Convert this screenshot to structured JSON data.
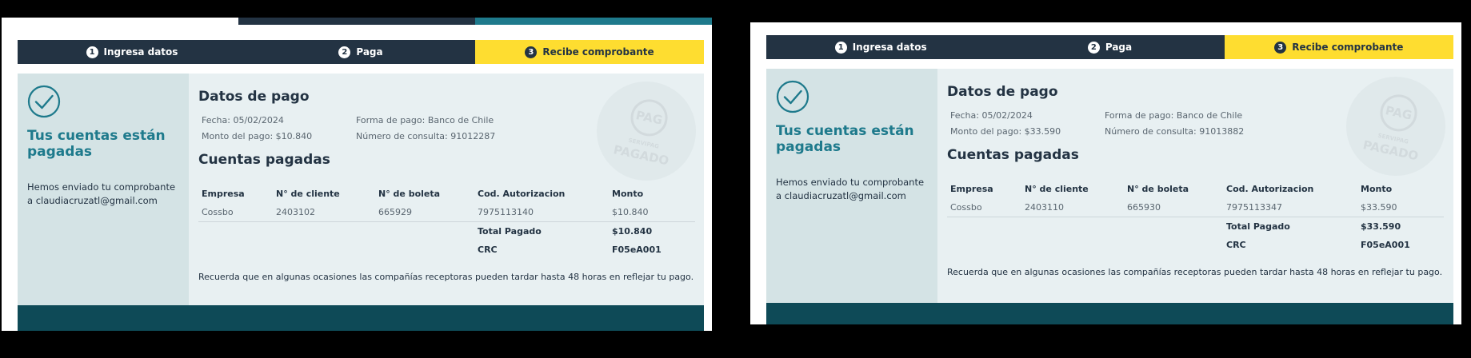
{
  "colors": {
    "background": "#000000",
    "card": "#ffffff",
    "navy": "#233343",
    "accent_yellow": "#fedd30",
    "teal_title": "#1e7a8c",
    "teal_dark": "#0e4a57",
    "side_panel": "#d4e3e5",
    "main_panel": "#e8f0f2",
    "stamp": "#d2dadd"
  },
  "receipts": [
    {
      "topbar": [
        "#ffffff",
        "#233343",
        "#1e7a8c"
      ],
      "steps": [
        {
          "number": "1",
          "label": "Ingresa datos",
          "active": false
        },
        {
          "number": "2",
          "label": "Paga",
          "active": false
        },
        {
          "number": "3",
          "label": "Recibe comprobante",
          "active": true
        }
      ],
      "side": {
        "icon": "check-circle-icon",
        "title": "Tus cuentas están pagadas",
        "message": "Hemos enviado tu comprobante a claudiacruzatl@gmail.com"
      },
      "payment": {
        "heading": "Datos de pago",
        "fecha": "Fecha: 05/02/2024",
        "forma": "Forma de pago: Banco de Chile",
        "monto": "Monto del pago: $10.840",
        "consulta": "Número de consulta: 91012287"
      },
      "paid": {
        "heading": "Cuentas pagadas",
        "headers": [
          "Empresa",
          "N° de cliente",
          "N° de boleta",
          "Cod. Autorizacion",
          "Monto"
        ],
        "row": [
          "Cossbo",
          "2403102",
          "665929",
          "7975113140",
          "$10.840"
        ],
        "total_label": "Total Pagado",
        "total_value": "$10.840",
        "crc_label": "CRC",
        "crc_value": "F05eA001"
      },
      "note": "Recuerda que en algunas ocasiones las compañías receptoras pueden tardar hasta 48 horas en reflejar tu pago.",
      "stamp": {
        "logo": "PAG",
        "sub": "SERVIPAG",
        "main": "PAGADO"
      }
    },
    {
      "topbar": [],
      "steps": [
        {
          "number": "1",
          "label": "Ingresa datos",
          "active": false
        },
        {
          "number": "2",
          "label": "Paga",
          "active": false
        },
        {
          "number": "3",
          "label": "Recibe comprobante",
          "active": true
        }
      ],
      "side": {
        "icon": "check-circle-icon",
        "title": "Tus cuentas están pagadas",
        "message": "Hemos enviado tu comprobante a claudiacruzatl@gmail.com"
      },
      "payment": {
        "heading": "Datos de pago",
        "fecha": "Fecha: 05/02/2024",
        "forma": "Forma de pago: Banco de Chile",
        "monto": "Monto del pago: $33.590",
        "consulta": "Número de consulta: 91013882"
      },
      "paid": {
        "heading": "Cuentas pagadas",
        "headers": [
          "Empresa",
          "N° de cliente",
          "N° de boleta",
          "Cod. Autorizacion",
          "Monto"
        ],
        "row": [
          "Cossbo",
          "2403110",
          "665930",
          "7975113347",
          "$33.590"
        ],
        "total_label": "Total Pagado",
        "total_value": "$33.590",
        "crc_label": "CRC",
        "crc_value": "F05eA001"
      },
      "note": "Recuerda que en algunas ocasiones las compañías receptoras pueden tardar hasta 48 horas en reflejar tu pago.",
      "stamp": {
        "logo": "PAG",
        "sub": "SERVIPAG",
        "main": "PAGADO"
      }
    }
  ]
}
